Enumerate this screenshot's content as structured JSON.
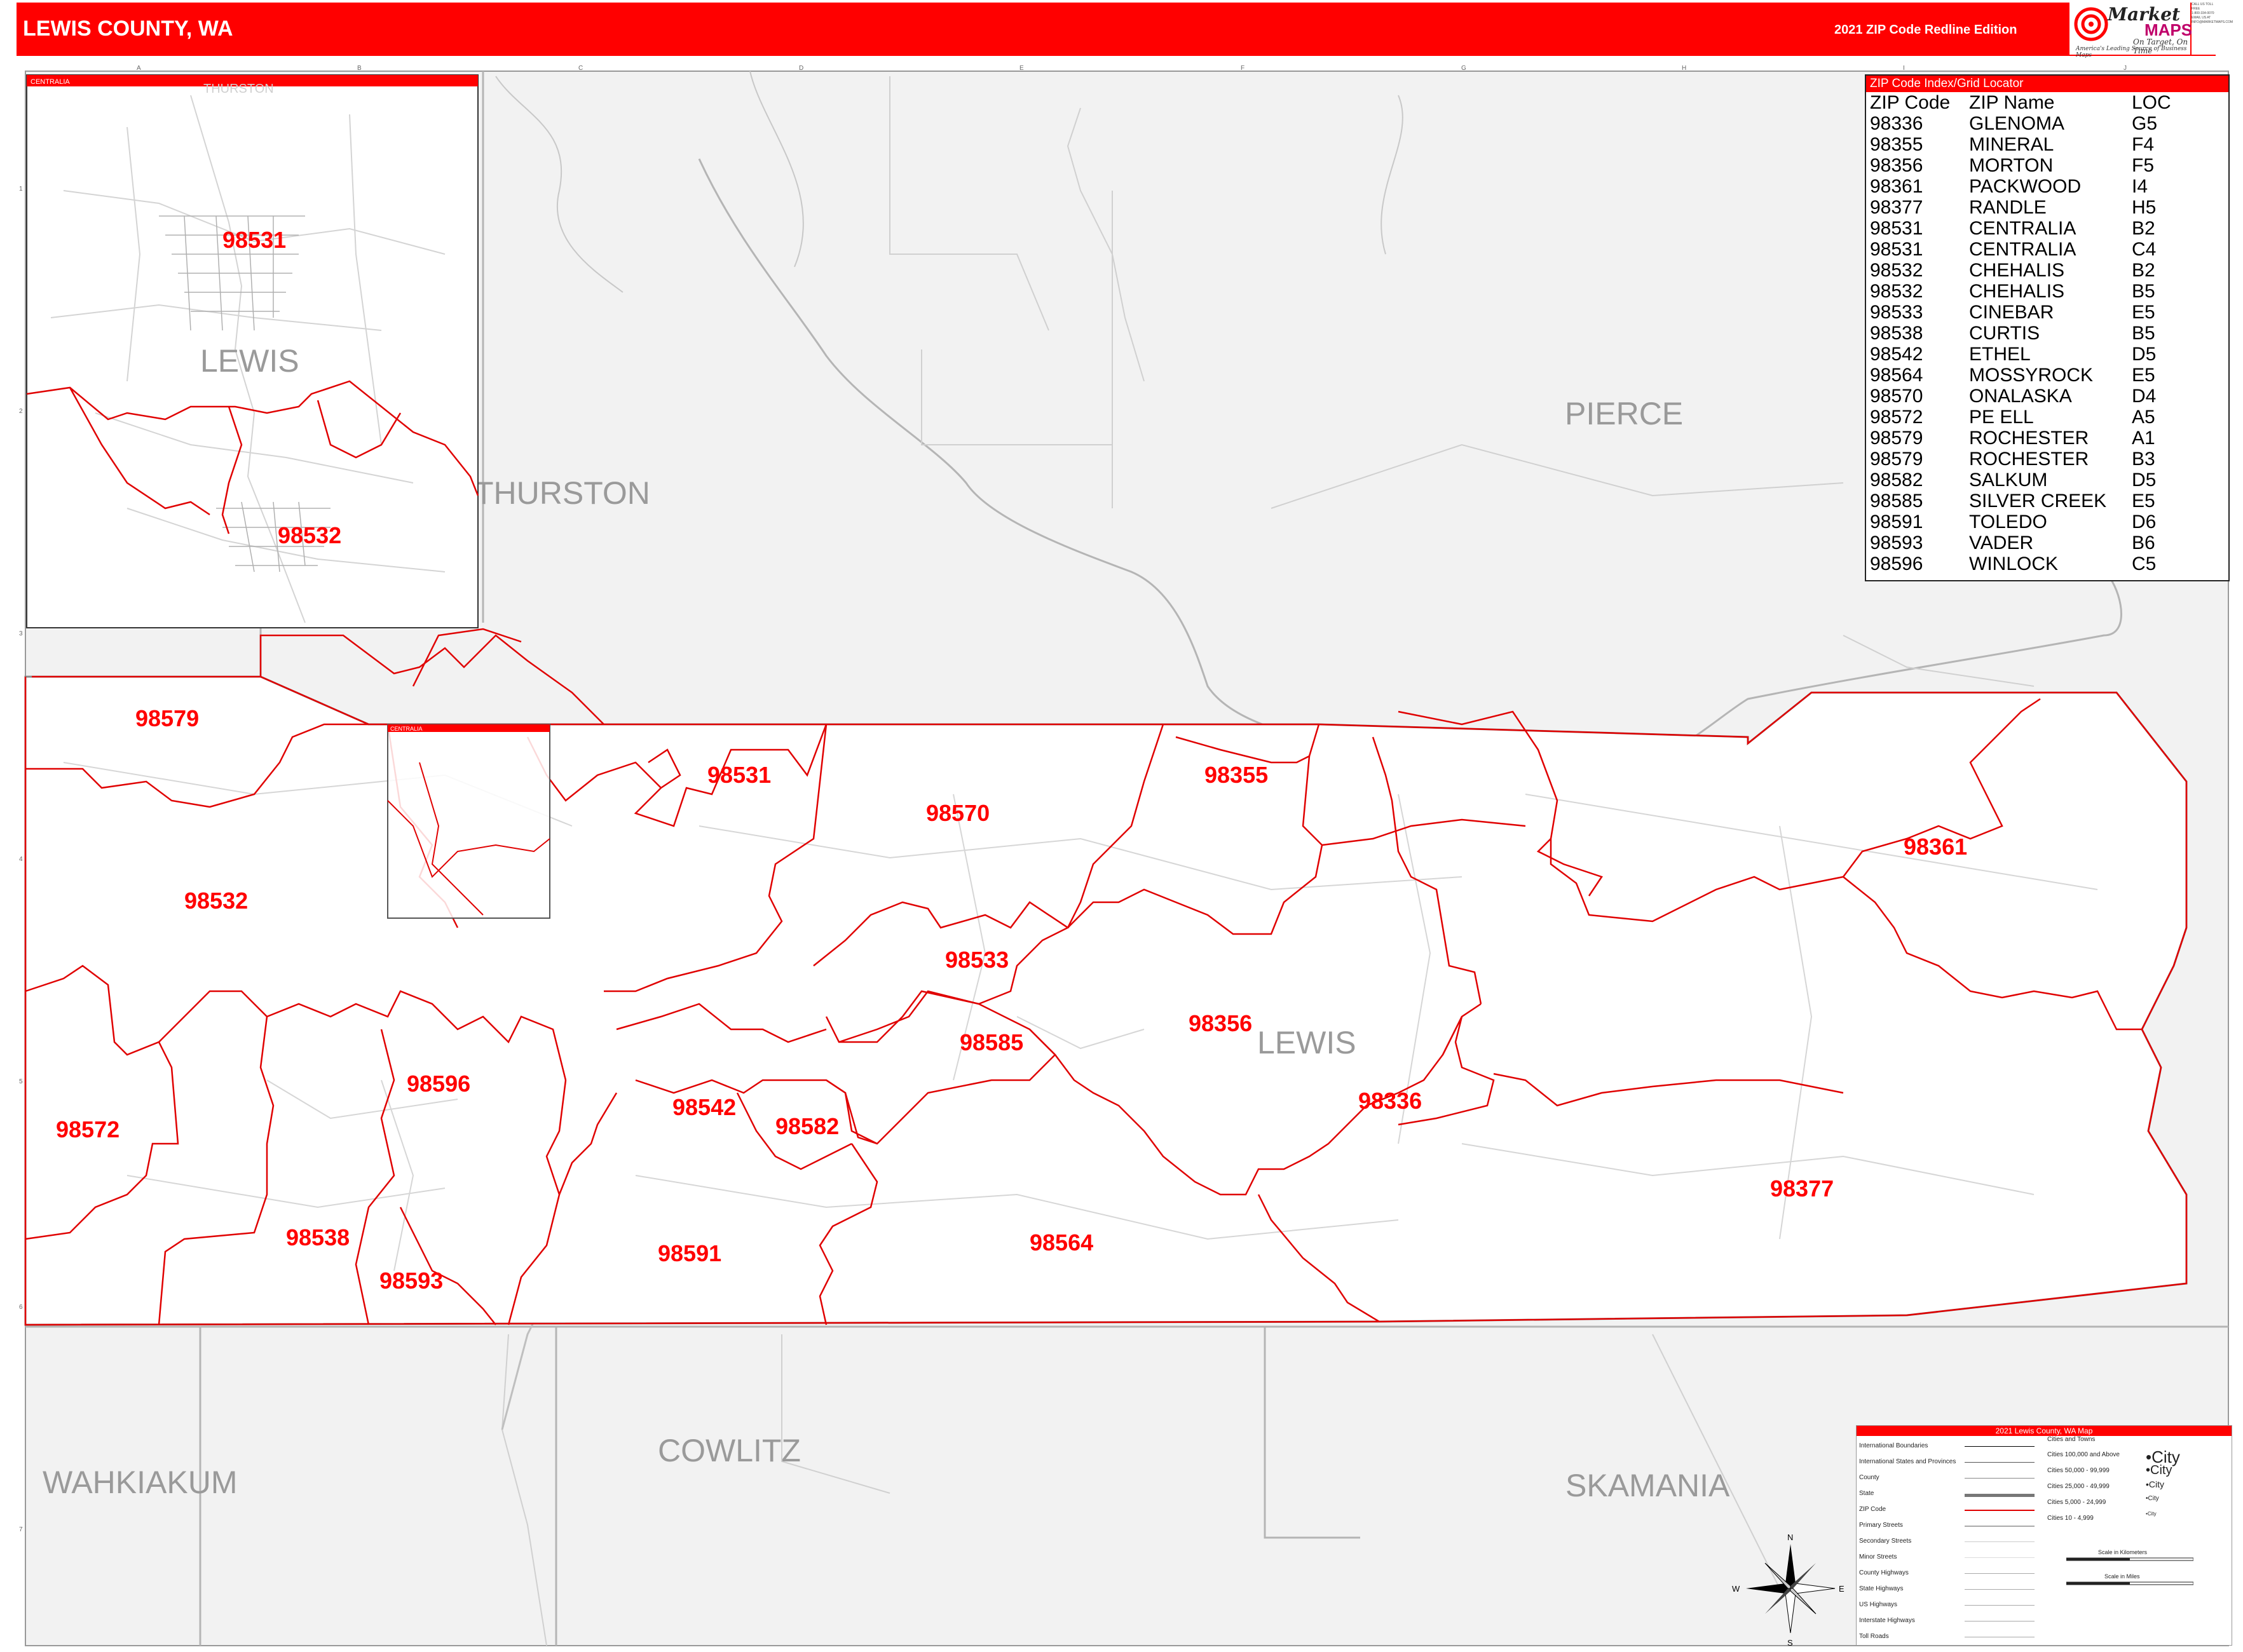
{
  "header": {
    "title": "LEWIS COUNTY, WA",
    "edition": "2021 ZIP Code Redline Edition",
    "logo": {
      "word1": "Market",
      "word2": "MAPS",
      "tagline": "On Target, On Time",
      "subline": "America's Leading Source of Business Maps"
    },
    "contact": [
      "CALL US TOLL FREE",
      "1-800-334-0070",
      "EMAIL US AT",
      "INFO@MARKETMAPS.COM"
    ]
  },
  "colors": {
    "brand_red": "#ff0000",
    "land_gray": "#f2f2f2",
    "county_line": "#bbbbbb",
    "zip_line": "#e00000"
  },
  "grid": {
    "columns": [
      "A",
      "B",
      "C",
      "D",
      "E",
      "F",
      "G",
      "H",
      "I",
      "J"
    ],
    "rows": [
      "1",
      "2",
      "3",
      "4",
      "5",
      "6",
      "7"
    ]
  },
  "inset": {
    "title": "CENTRALIA",
    "zip_labels": [
      "98531",
      "98532"
    ],
    "county_label": "LEWIS",
    "other_text": "THURSTON"
  },
  "main_inset_box_title": "CENTRALIA",
  "county_labels": {
    "pierce": "PIERCE",
    "thurston": "THURSTON",
    "lewis": "LEWIS",
    "cowlitz": "COWLITZ",
    "wahkiakum": "WAHKIAKUM",
    "skamania": "SKAMANIA"
  },
  "zip_labels": {
    "z98579": "98579",
    "z98531": "98531",
    "z98570": "98570",
    "z98355": "98355",
    "z98361": "98361",
    "z98532": "98532",
    "z98533": "98533",
    "z98585": "98585",
    "z98356": "98356",
    "z98596": "98596",
    "z98572": "98572",
    "z98542": "98542",
    "z98582": "98582",
    "z98336": "98336",
    "z98377": "98377",
    "z98538": "98538",
    "z98591": "98591",
    "z98564": "98564",
    "z98593": "98593"
  },
  "zip_index": {
    "title": "ZIP Code Index/Grid Locator",
    "columns": [
      "ZIP Code",
      "ZIP Name",
      "LOC"
    ],
    "rows": [
      [
        "98336",
        "GLENOMA",
        "G5"
      ],
      [
        "98355",
        "MINERAL",
        "F4"
      ],
      [
        "98356",
        "MORTON",
        "F5"
      ],
      [
        "98361",
        "PACKWOOD",
        "I4"
      ],
      [
        "98377",
        "RANDLE",
        "H5"
      ],
      [
        "98531",
        "CENTRALIA",
        "B2"
      ],
      [
        "98531",
        "CENTRALIA",
        "C4"
      ],
      [
        "98532",
        "CHEHALIS",
        "B2"
      ],
      [
        "98532",
        "CHEHALIS",
        "B5"
      ],
      [
        "98533",
        "CINEBAR",
        "E5"
      ],
      [
        "98538",
        "CURTIS",
        "B5"
      ],
      [
        "98542",
        "ETHEL",
        "D5"
      ],
      [
        "98564",
        "MOSSYROCK",
        "E5"
      ],
      [
        "98570",
        "ONALASKA",
        "D4"
      ],
      [
        "98572",
        "PE ELL",
        "A5"
      ],
      [
        "98579",
        "ROCHESTER",
        "A1"
      ],
      [
        "98579",
        "ROCHESTER",
        "B3"
      ],
      [
        "98582",
        "SALKUM",
        "D5"
      ],
      [
        "98585",
        "SILVER CREEK",
        "E5"
      ],
      [
        "98591",
        "TOLEDO",
        "D6"
      ],
      [
        "98593",
        "VADER",
        "B6"
      ],
      [
        "98596",
        "WINLOCK",
        "C5"
      ]
    ]
  },
  "legend": {
    "title": "2021 Lewis County, WA Map",
    "lines": [
      "International Boundaries",
      "International States and Provinces",
      "County",
      "State",
      "ZIP Code",
      "Primary Streets",
      "Secondary Streets",
      "Minor Streets",
      "County Highways",
      "State Highways",
      "US Highways",
      "Interstate Highways",
      "Toll Roads"
    ],
    "cities_header": "Cities and Towns",
    "cities": [
      {
        "range": "Cities 100,000 and Above",
        "sample": "City"
      },
      {
        "range": "Cities 50,000 - 99,999",
        "sample": "City"
      },
      {
        "range": "Cities 25,000 - 49,999",
        "sample": "City"
      },
      {
        "range": "Cities 5,000 - 24,999",
        "sample": "City"
      },
      {
        "range": "Cities 10 - 4,999",
        "sample": "City"
      }
    ],
    "scale_km": "Scale in Kilometers",
    "scale_mi": "Scale in Miles"
  },
  "compass": {
    "n": "N",
    "s": "S",
    "e": "E",
    "w": "W"
  }
}
